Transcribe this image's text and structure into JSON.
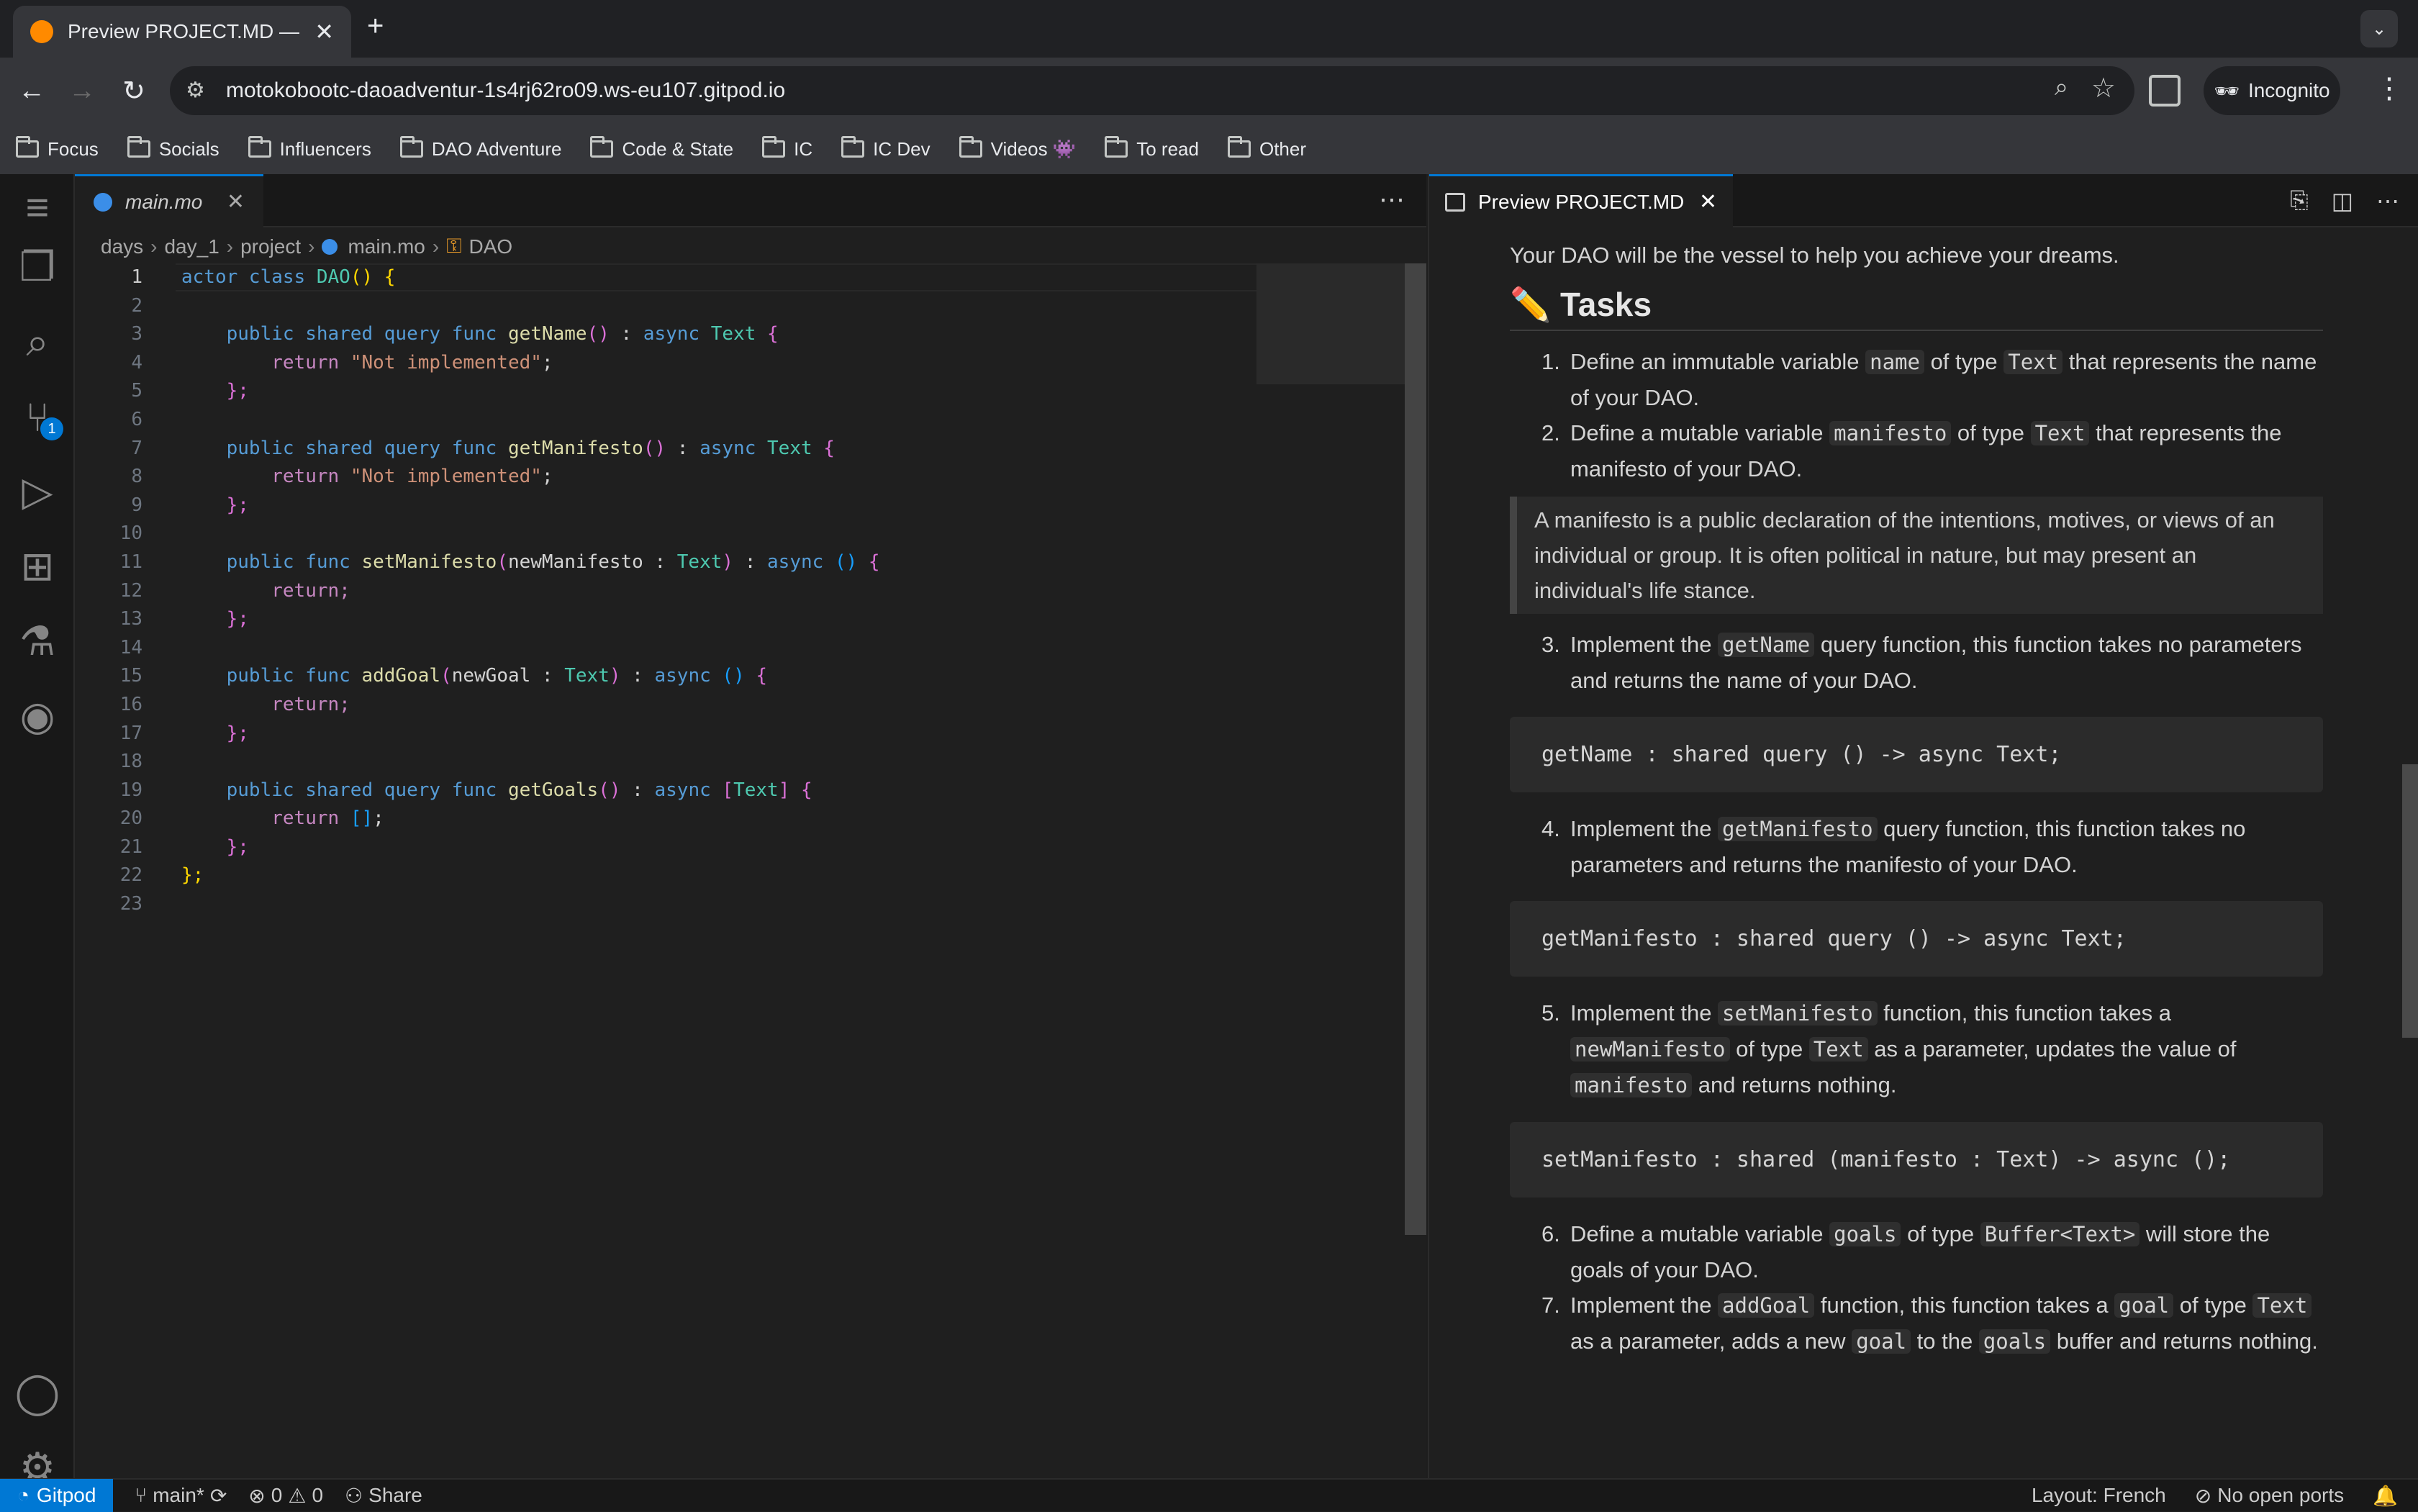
{
  "browser": {
    "tab_title": "Preview PROJECT.MD — dao",
    "url": "motokobootc-daoadventur-1s4rj62ro09.ws-eu107.gitpod.io",
    "incognito_label": "Incognito",
    "bookmarks": [
      "Focus",
      "Socials",
      "Influencers",
      "DAO Adventure",
      "Code & State",
      "IC",
      "IC Dev",
      "Videos 👾",
      "To read",
      "Other"
    ]
  },
  "editor": {
    "tab_label": "main.mo",
    "breadcrumbs": [
      "days",
      "day_1",
      "project",
      "main.mo",
      "DAO"
    ],
    "line_numbers": [
      "1",
      "2",
      "3",
      "4",
      "5",
      "6",
      "7",
      "8",
      "9",
      "10",
      "11",
      "12",
      "13",
      "14",
      "15",
      "16",
      "17",
      "18",
      "19",
      "20",
      "21",
      "22",
      "23"
    ],
    "code": {
      "l1_kw1": "actor class ",
      "l1_name": "DAO",
      "l1_paren": "()",
      "l1_brace": " {",
      "l3_kw": "public shared query func ",
      "l3_fn": "getName",
      "l3_p": "()",
      "l3_c": " : ",
      "l3_async": "async ",
      "l3_ty": "Text",
      "l3_b": " {",
      "l4_ret": "return ",
      "l4_str": "\"Not implemented\"",
      "l4_end": ";",
      "l5": "};",
      "l7_kw": "public shared query func ",
      "l7_fn": "getManifesto",
      "l7_p": "()",
      "l7_c": " : ",
      "l7_async": "async ",
      "l7_ty": "Text",
      "l7_b": " {",
      "l8_ret": "return ",
      "l8_str": "\"Not implemented\"",
      "l8_end": ";",
      "l9": "};",
      "l11_kw": "public func ",
      "l11_fn": "setManifesto",
      "l11_po": "(",
      "l11_arg": "newManifesto",
      "l11_c": " : ",
      "l11_ty": "Text",
      "l11_pc": ")",
      "l11_c2": " : ",
      "l11_async": "async ",
      "l11_unit": "()",
      "l11_b": " {",
      "l12": "return;",
      "l13": "};",
      "l15_kw": "public func ",
      "l15_fn": "addGoal",
      "l15_po": "(",
      "l15_arg": "newGoal",
      "l15_c": " : ",
      "l15_ty": "Text",
      "l15_pc": ")",
      "l15_c2": " : ",
      "l15_async": "async ",
      "l15_unit": "()",
      "l15_b": " {",
      "l16": "return;",
      "l17": "};",
      "l19_kw": "public shared query func ",
      "l19_fn": "getGoals",
      "l19_p": "()",
      "l19_c": " : ",
      "l19_async": "async ",
      "l19_bo": "[",
      "l19_ty": "Text",
      "l19_bc": "]",
      "l19_b": " {",
      "l20_ret": "return ",
      "l20_arr": "[]",
      "l20_end": ";",
      "l21": "};",
      "l22": "};"
    }
  },
  "preview": {
    "tab_label": "Preview PROJECT.MD",
    "intro": "Your DAO will be the vessel to help you achieve your dreams.",
    "heading": "✏️ Tasks",
    "item1": {
      "num": "1.",
      "a": "Define an immutable variable ",
      "code1": "name",
      "b": " of type ",
      "code2": "Text",
      "c": " that represents the name of your DAO."
    },
    "item2": {
      "num": "2.",
      "a": "Define a mutable variable ",
      "code1": "manifesto",
      "b": " of type ",
      "code2": "Text",
      "c": " that represents the manifesto of your DAO."
    },
    "quote": "A manifesto is a public declaration of the intentions, motives, or views of an individual or group. It is often political in nature, but may present an individual's life stance.",
    "item3": {
      "num": "3.",
      "a": "Implement the ",
      "code1": "getName",
      "c": " query function, this function takes no parameters and returns the name of your DAO."
    },
    "code3": "getName : shared query () -> async Text;",
    "item4": {
      "num": "4.",
      "a": "Implement the ",
      "code1": "getManifesto",
      "c": " query function, this function takes no parameters and returns the manifesto of your DAO."
    },
    "code4": "getManifesto : shared query () -> async Text;",
    "item5": {
      "num": "5.",
      "a": "Implement the ",
      "code1": "setManifesto",
      "b": " function, this function takes a ",
      "code2": "newManifesto",
      "c": " of type ",
      "code3": "Text",
      "d": " as a parameter, updates the value of ",
      "code4": "manifesto",
      "e": " and returns nothing."
    },
    "code5": "setManifesto : shared (manifesto : Text) -> async ();",
    "item6": {
      "num": "6.",
      "a": "Define a mutable variable ",
      "code1": "goals",
      "b": " of type ",
      "code2": "Buffer<Text>",
      "c": " will store the goals of your DAO."
    },
    "item7": {
      "num": "7.",
      "a": "Implement the ",
      "code1": "addGoal",
      "b": " function, this function takes a ",
      "code2": "goal",
      "c": " of type ",
      "code3": "Text",
      "d": " as a parameter, adds a new ",
      "code4": "goal",
      "e": " to the ",
      "code5": "goals",
      "f": " buffer and returns nothing."
    }
  },
  "status": {
    "remote": "Gitpod",
    "branch": "main*",
    "errors": "0",
    "warnings": "0",
    "share": "Share",
    "layout": "Layout: French",
    "ports": "No open ports"
  }
}
